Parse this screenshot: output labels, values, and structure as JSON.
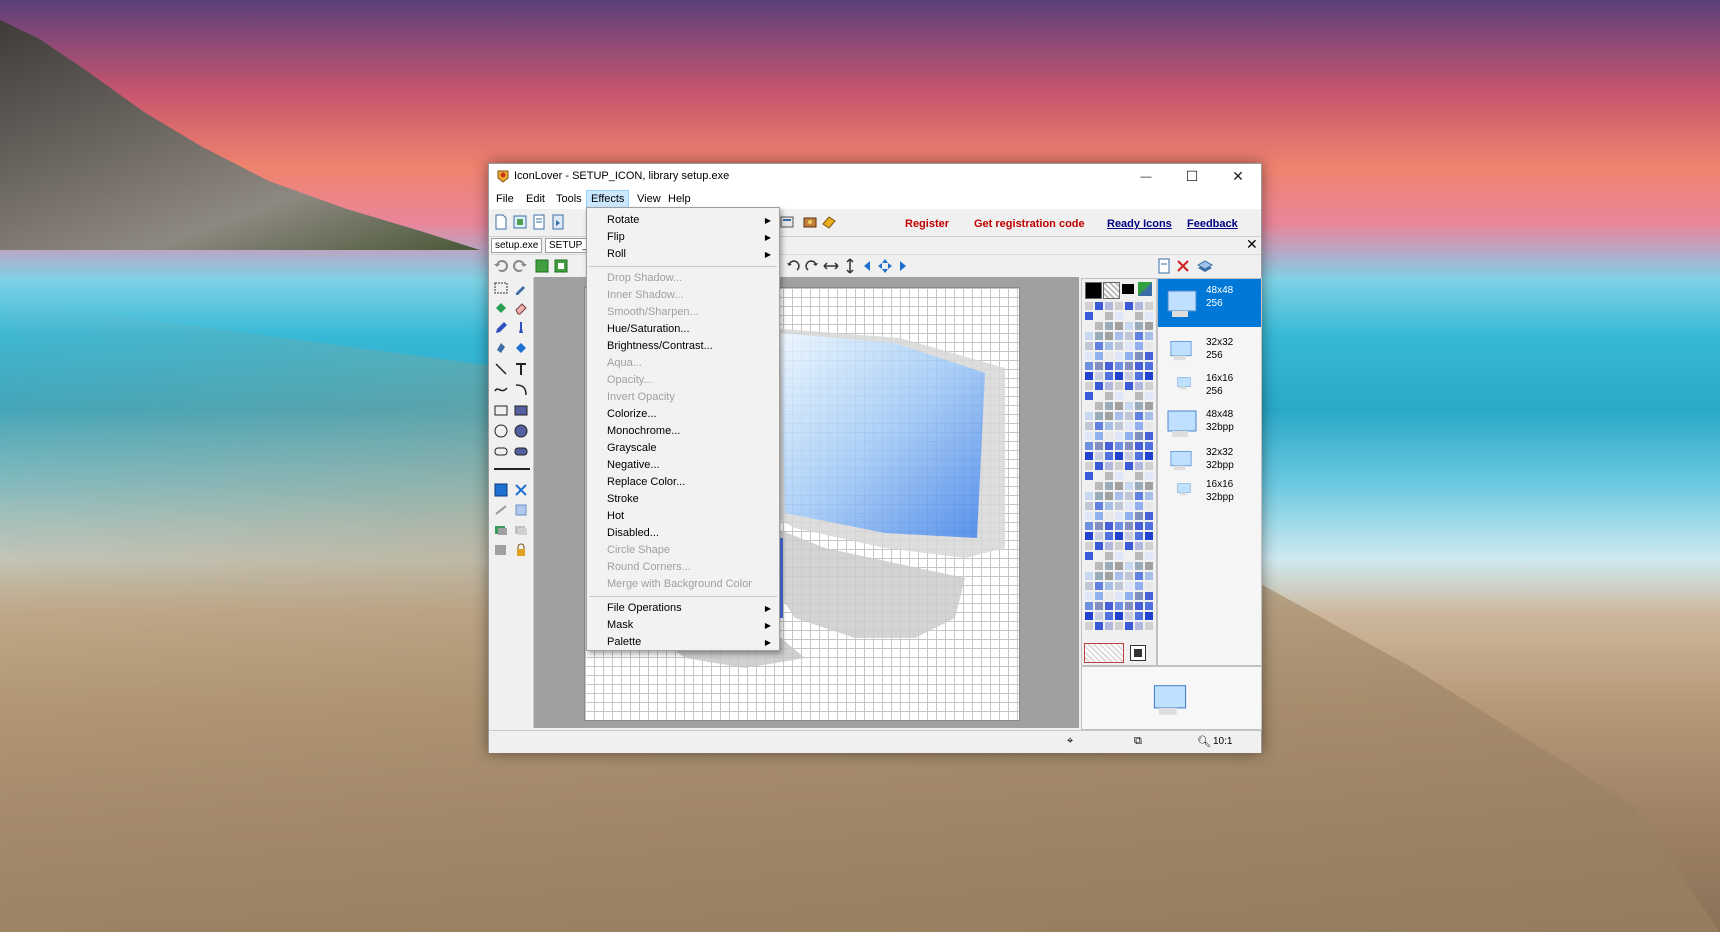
{
  "window": {
    "title": "IconLover - SETUP_ICON, library setup.exe",
    "min_glyph": "—",
    "max_glyph": "☐",
    "close_glyph": "✕"
  },
  "menubar": {
    "items": [
      {
        "label": "File"
      },
      {
        "label": "Edit"
      },
      {
        "label": "Tools"
      },
      {
        "label": "Effects"
      },
      {
        "label": "View"
      },
      {
        "label": "Help"
      }
    ]
  },
  "toolbar": {
    "register": "Register",
    "get_code": "Get registration code",
    "ready_icons": "Ready Icons",
    "feedback": "Feedback",
    "link_red": "#c00000",
    "link_blue": "#000080"
  },
  "tabs": {
    "library": "setup.exe",
    "icon": "SETUP_"
  },
  "effects_menu": {
    "groups": [
      [
        {
          "label": "Rotate",
          "enabled": true,
          "submenu": true
        },
        {
          "label": "Flip",
          "enabled": true,
          "submenu": true
        },
        {
          "label": "Roll",
          "enabled": true,
          "submenu": true
        }
      ],
      [
        {
          "label": "Drop Shadow...",
          "enabled": false
        },
        {
          "label": "Inner Shadow...",
          "enabled": false
        },
        {
          "label": "Smooth/Sharpen...",
          "enabled": false
        },
        {
          "label": "Hue/Saturation...",
          "enabled": true
        },
        {
          "label": "Brightness/Contrast...",
          "enabled": true
        },
        {
          "label": "Aqua...",
          "enabled": false
        },
        {
          "label": "Opacity...",
          "enabled": false
        },
        {
          "label": "Invert Opacity",
          "enabled": false
        },
        {
          "label": "Colorize...",
          "enabled": true
        },
        {
          "label": "Monochrome...",
          "enabled": true
        },
        {
          "label": "Grayscale",
          "enabled": true
        },
        {
          "label": "Negative...",
          "enabled": true
        },
        {
          "label": "Replace Color...",
          "enabled": true
        },
        {
          "label": "Stroke",
          "enabled": true
        },
        {
          "label": "Hot",
          "enabled": true
        },
        {
          "label": "Disabled...",
          "enabled": true
        },
        {
          "label": "Circle Shape",
          "enabled": false
        },
        {
          "label": "Round Corners...",
          "enabled": false
        },
        {
          "label": "Merge with Background Color",
          "enabled": false
        }
      ],
      [
        {
          "label": "File Operations",
          "enabled": true,
          "submenu": true
        },
        {
          "label": "Mask",
          "enabled": true,
          "submenu": true
        },
        {
          "label": "Palette",
          "enabled": true,
          "submenu": true
        }
      ]
    ]
  },
  "formats": [
    {
      "size": "48x48",
      "depth": "256",
      "selected": true
    },
    {
      "size": "32x32",
      "depth": "256",
      "selected": false
    },
    {
      "size": "16x16",
      "depth": "256",
      "selected": false
    },
    {
      "size": "48x48",
      "depth": "32bpp",
      "selected": false
    },
    {
      "size": "32x32",
      "depth": "32bpp",
      "selected": false
    },
    {
      "size": "16x16",
      "depth": "32bpp",
      "selected": false
    }
  ],
  "status": {
    "zoom": "10:1"
  },
  "icons": {
    "app": "iconlover-app-icon",
    "zoom": "magnifier-icon"
  },
  "colors": {
    "selection": "#0078d7",
    "menu_hover": "#cce8ff"
  }
}
